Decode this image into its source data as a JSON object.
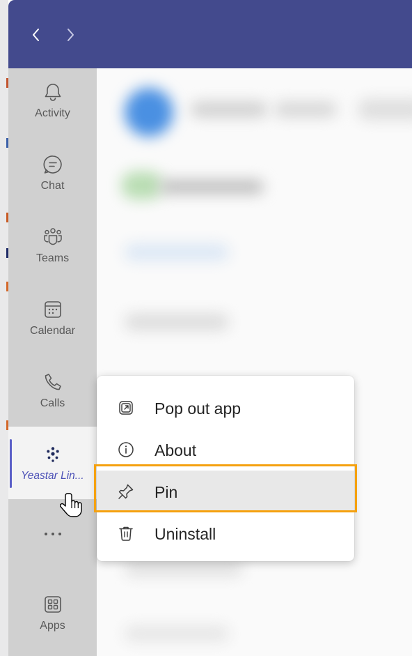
{
  "titlebar": {
    "back": "<",
    "forward": ">"
  },
  "rail": {
    "items": [
      {
        "label": "Activity",
        "icon": "bell-icon"
      },
      {
        "label": "Chat",
        "icon": "chat-icon"
      },
      {
        "label": "Teams",
        "icon": "teams-icon"
      },
      {
        "label": "Calendar",
        "icon": "calendar-icon"
      },
      {
        "label": "Calls",
        "icon": "phone-icon"
      },
      {
        "label": "Yeastar Lin...",
        "icon": "yeastar-icon",
        "active": true
      },
      {
        "label": "",
        "icon": "more-icon"
      },
      {
        "label": "Apps",
        "icon": "apps-icon"
      }
    ]
  },
  "context_menu": {
    "items": [
      {
        "label": "Pop out app",
        "icon": "pop-out-icon"
      },
      {
        "label": "About",
        "icon": "info-icon"
      },
      {
        "label": "Pin",
        "icon": "pin-icon",
        "highlighted": true
      },
      {
        "label": "Uninstall",
        "icon": "trash-icon"
      }
    ]
  },
  "colors": {
    "titlebar": "#434a8d",
    "rail": "#d0d0d0",
    "active_indicator": "#5b5fc7",
    "highlight_border": "#f5a10f"
  }
}
